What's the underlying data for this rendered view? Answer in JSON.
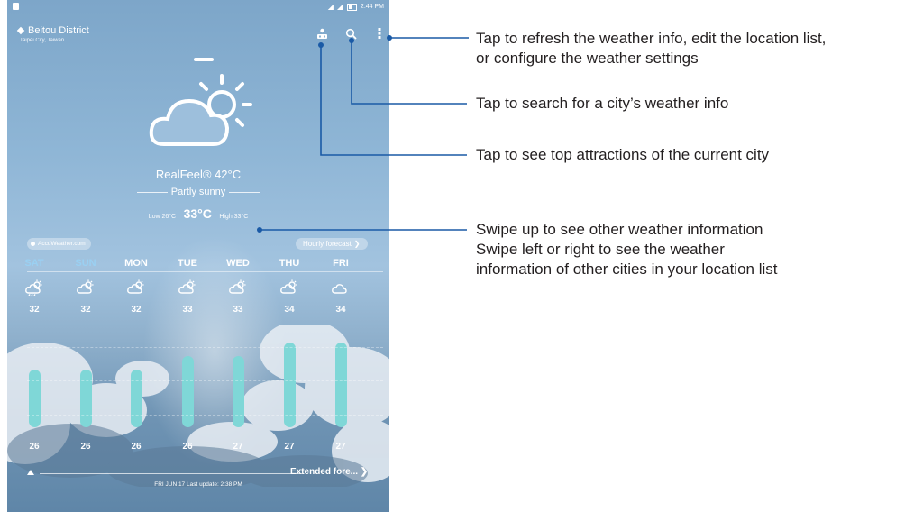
{
  "status_bar": {
    "time": "2:44 PM"
  },
  "location": {
    "name": "Beitou District",
    "region": "Taipei City, Taiwan"
  },
  "top_icons": [
    "attractions-icon",
    "search-icon",
    "more-options-icon"
  ],
  "current": {
    "condition_icon": "partly-sunny-icon",
    "realfeel": "RealFeel® 42°C",
    "condition": "Partly sunny",
    "low": "Low 26°C",
    "temp": "33°C",
    "high": "High 33°C"
  },
  "accuweather_label": "AccuWeather.com",
  "hourly_label": "Hourly forecast",
  "forecast": [
    {
      "day": "SAT",
      "high": "32",
      "low": "26",
      "weekend": true,
      "icon": "thunder-shower-icon"
    },
    {
      "day": "SUN",
      "high": "32",
      "low": "26",
      "weekend": true,
      "icon": "partly-cloudy-icon"
    },
    {
      "day": "MON",
      "high": "32",
      "low": "26",
      "weekend": false,
      "icon": "partly-cloudy-icon"
    },
    {
      "day": "TUE",
      "high": "33",
      "low": "26",
      "weekend": false,
      "icon": "partly-cloudy-icon"
    },
    {
      "day": "WED",
      "high": "33",
      "low": "27",
      "weekend": false,
      "icon": "partly-sunny-icon"
    },
    {
      "day": "THU",
      "high": "34",
      "low": "27",
      "weekend": false,
      "icon": "partly-sunny-icon"
    },
    {
      "day": "FRI",
      "high": "34",
      "low": "27",
      "weekend": false,
      "icon": "cloudy-icon"
    }
  ],
  "extended_label": "Extended fore...",
  "last_update": "FRI JUN 17 Last update: 2:38 PM",
  "callouts": {
    "menu_line1": "Tap to refresh the weather info, edit the location list,",
    "menu_line2": "or configure the weather settings",
    "search": "Tap to search for a city’s weather info",
    "attractions": "Tap to see top attractions of the current city",
    "swipe_line1": "Swipe up to see other weather information",
    "swipe_line2": "Swipe left or right to see the weather",
    "swipe_line3": "information of other cities in your location list"
  },
  "colors": {
    "leader_line": "#1a5aa6",
    "bar": "#7fd7d7",
    "weekend_day": "#9ad0f2"
  }
}
